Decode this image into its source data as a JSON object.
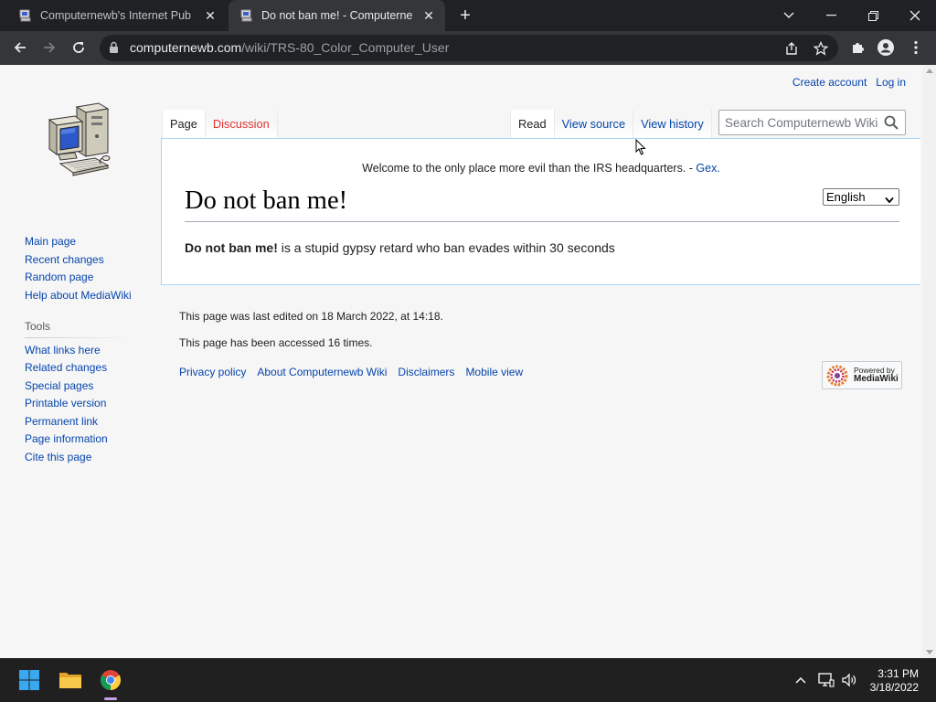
{
  "browser": {
    "tabs": [
      {
        "title": "Computernewb's Internet Pub H",
        "active": false
      },
      {
        "title": "Do not ban me! - Computernewb",
        "active": true
      }
    ],
    "new_tab_label": "+",
    "url_host": "computernewb.com",
    "url_path": "/wiki/TRS-80_Color_Computer_User"
  },
  "wiki": {
    "personal": {
      "create_account": "Create account",
      "log_in": "Log in"
    },
    "sidebar": {
      "navigation": [
        "Main page",
        "Recent changes",
        "Random page",
        "Help about MediaWiki"
      ],
      "tools_heading": "Tools",
      "tools": [
        "What links here",
        "Related changes",
        "Special pages",
        "Printable version",
        "Permanent link",
        "Page information",
        "Cite this page"
      ]
    },
    "tabs": {
      "page": "Page",
      "discussion": "Discussion",
      "read": "Read",
      "view_source": "View source",
      "view_history": "View history"
    },
    "search": {
      "placeholder": "Search Computernewb Wiki"
    },
    "sitenotice": {
      "text": "Welcome to the only place more evil than the IRS headquarters. - ",
      "link": "Gex."
    },
    "language": {
      "selected": "English"
    },
    "page_title": "Do not ban me!",
    "body": {
      "bold": "Do not ban me!",
      "rest": " is a stupid gypsy retard who ban evades within 30 seconds"
    },
    "footer": {
      "last_edited": "This page was last edited on 18 March 2022, at 14:18.",
      "accessed": "This page has been accessed 16 times.",
      "links": [
        "Privacy policy",
        "About Computernewb Wiki",
        "Disclaimers",
        "Mobile view"
      ],
      "powered_by_line1": "Powered by",
      "powered_by_line2": "MediaWiki"
    }
  },
  "taskbar": {
    "time": "3:31 PM",
    "date": "3/18/2022"
  }
}
